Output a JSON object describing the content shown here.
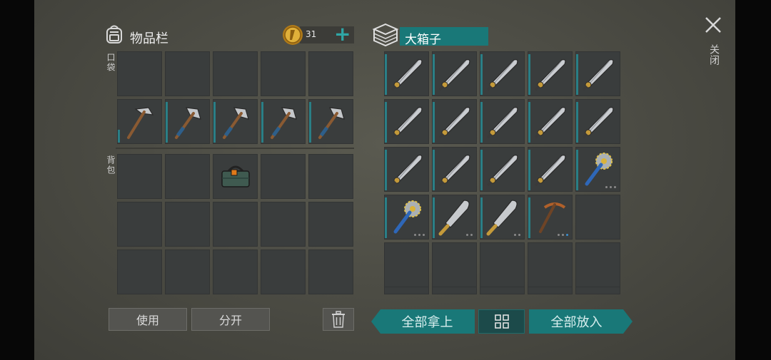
{
  "inventory": {
    "title": "物品栏",
    "coins": "31",
    "add_symbol": "+",
    "pocket_label": "口袋",
    "backpack_label": "背包"
  },
  "chest": {
    "title": "大箱子"
  },
  "close_label": "关闭",
  "buttons": {
    "use": "使用",
    "split": "分开",
    "take_all": "全部拿上",
    "put_all": "全部放入"
  },
  "colors": {
    "accent_teal": "#197878",
    "indicator": "#2a7f86",
    "coin": "#d9a62e"
  },
  "icons": {
    "inventory": "backpack-icon",
    "chest": "crate-icon",
    "close": "close-icon",
    "trash": "trash-icon",
    "sort": "grid-sort-icon",
    "coin": "coin-icon"
  },
  "pocket_items": [
    "empty",
    "empty",
    "empty",
    "empty",
    "empty",
    "iron-pickaxe",
    "hatchet",
    "hatchet",
    "hatchet",
    "hatchet"
  ],
  "backpack_items": [
    "empty",
    "empty",
    "toolbox",
    "empty",
    "empty",
    "empty",
    "empty",
    "empty",
    "empty",
    "empty",
    "empty",
    "empty",
    "empty",
    "empty",
    "empty"
  ],
  "chest_items": [
    "sword",
    "sword",
    "sword",
    "sword",
    "sword",
    "sword",
    "sword",
    "sword",
    "sword",
    "sword",
    "sword",
    "sword",
    "sword",
    "sword",
    "saw-mace",
    "saw-mace",
    "machete",
    "machete",
    "copper-pickaxe",
    "empty",
    "empty",
    "empty",
    "empty",
    "empty",
    "empty"
  ]
}
